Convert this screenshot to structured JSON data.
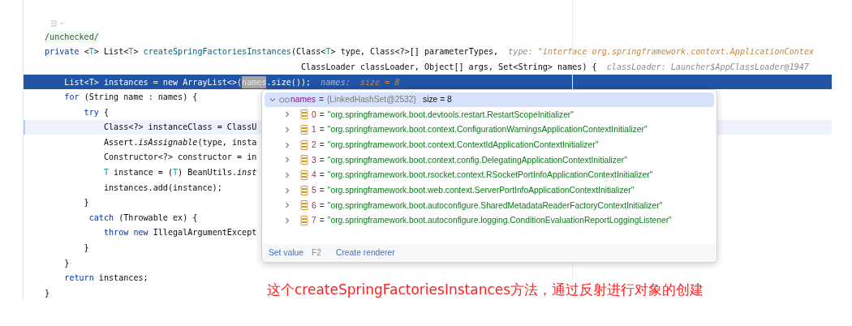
{
  "code_lines": [
    {
      "executing": false,
      "caret_line": false,
      "tokens": [
        {
          "kind": "inlay",
          "text": "/unchecked/"
        }
      ]
    },
    {
      "executing": false,
      "caret_line": false,
      "tokens": [
        {
          "kind": "kw",
          "text": "private "
        },
        {
          "kind": "plain",
          "text": "<"
        },
        {
          "kind": "tparam",
          "text": "T"
        },
        {
          "kind": "plain",
          "text": "> List<"
        },
        {
          "kind": "tparam",
          "text": "T"
        },
        {
          "kind": "plain",
          "text": "> "
        },
        {
          "kind": "method",
          "text": "createSpringFactoriesInstances"
        },
        {
          "kind": "plain",
          "text": "(Class<"
        },
        {
          "kind": "tparam",
          "text": "T"
        },
        {
          "kind": "plain",
          "text": "> type, Class<?>[] parameterTypes,  "
        },
        {
          "kind": "hint-name",
          "text": "type: "
        },
        {
          "kind": "hint-value",
          "text": "\"interface org.springframework.context.ApplicationContex"
        }
      ]
    },
    {
      "executing": false,
      "caret_line": false,
      "tokens": [
        {
          "kind": "plain",
          "text": "                                                    ClassLoader classLoader, Object[] args, Set<String> names) {  "
        },
        {
          "kind": "hint-name",
          "text": "classLoader: Launcher$AppClassLoader@1947"
        }
      ]
    },
    {
      "executing": true,
      "caret_line": false,
      "tokens": [
        {
          "kind": "plain",
          "text": "    List<T> instances = new ArrayList<>("
        },
        {
          "kind": "selected",
          "text": "names"
        },
        {
          "kind": "plain",
          "text": ".size());  "
        },
        {
          "kind": "hint-name",
          "text": "names:  "
        },
        {
          "kind": "hint-value",
          "text": "size = 8"
        }
      ]
    },
    {
      "executing": false,
      "caret_line": false,
      "tokens": [
        {
          "kind": "kw",
          "text": "    for "
        },
        {
          "kind": "plain",
          "text": "(String name : names) {"
        }
      ]
    },
    {
      "executing": false,
      "caret_line": false,
      "tokens": [
        {
          "kind": "kw",
          "text": "        try "
        },
        {
          "kind": "plain",
          "text": "{"
        }
      ]
    },
    {
      "executing": false,
      "caret_line": true,
      "tokens": [
        {
          "kind": "plain",
          "text": "            Class<?> instanceClass = ClassU"
        }
      ]
    },
    {
      "executing": false,
      "caret_line": false,
      "tokens": [
        {
          "kind": "plain",
          "text": "            Assert."
        },
        {
          "kind": "italic",
          "text": "isAssignable"
        },
        {
          "kind": "plain",
          "text": "(type, insta"
        }
      ]
    },
    {
      "executing": false,
      "caret_line": false,
      "tokens": [
        {
          "kind": "plain",
          "text": "            Constructor<?> constructor = in"
        }
      ]
    },
    {
      "executing": false,
      "caret_line": false,
      "tokens": [
        {
          "kind": "tparam",
          "text": "            T"
        },
        {
          "kind": "plain",
          "text": " instance = ("
        },
        {
          "kind": "tparam",
          "text": "T"
        },
        {
          "kind": "plain",
          "text": ") BeanUtils."
        },
        {
          "kind": "italic",
          "text": "inst"
        }
      ]
    },
    {
      "executing": false,
      "caret_line": false,
      "tokens": [
        {
          "kind": "plain",
          "text": "            instances.add(instance);"
        }
      ]
    },
    {
      "executing": false,
      "caret_line": false,
      "tokens": [
        {
          "kind": "plain",
          "text": "        }"
        }
      ]
    },
    {
      "executing": false,
      "caret_line": false,
      "tokens": [
        {
          "kind": "kw",
          "text": "         catch "
        },
        {
          "kind": "plain",
          "text": "(Throwable ex) {"
        }
      ]
    },
    {
      "executing": false,
      "caret_line": false,
      "tokens": [
        {
          "kind": "kw",
          "text": "            throw new "
        },
        {
          "kind": "plain",
          "text": "IllegalArgumentExcept"
        }
      ]
    },
    {
      "executing": false,
      "caret_line": false,
      "tokens": [
        {
          "kind": "plain",
          "text": "        }"
        }
      ]
    },
    {
      "executing": false,
      "caret_line": false,
      "tokens": [
        {
          "kind": "plain",
          "text": "    }"
        }
      ]
    },
    {
      "executing": false,
      "caret_line": false,
      "tokens": [
        {
          "kind": "kw",
          "text": "    return "
        },
        {
          "kind": "plain",
          "text": "instances;"
        }
      ]
    },
    {
      "executing": false,
      "caret_line": false,
      "tokens": [
        {
          "kind": "plain",
          "text": "}"
        }
      ]
    }
  ],
  "popup": {
    "header": {
      "expanded": true,
      "name": "names",
      "op": "=",
      "ref": "{LinkedHashSet@2532}",
      "extra": "size = 8"
    },
    "items": [
      {
        "expanded": false,
        "index": "0",
        "op": "=",
        "value": "\"org.springframework.boot.devtools.restart.RestartScopeInitializer\""
      },
      {
        "expanded": false,
        "index": "1",
        "op": "=",
        "value": "\"org.springframework.boot.context.ConfigurationWarningsApplicationContextInitializer\""
      },
      {
        "expanded": false,
        "index": "2",
        "op": "=",
        "value": "\"org.springframework.boot.context.ContextIdApplicationContextInitializer\""
      },
      {
        "expanded": false,
        "index": "3",
        "op": "=",
        "value": "\"org.springframework.boot.context.config.DelegatingApplicationContextInitializer\""
      },
      {
        "expanded": false,
        "index": "4",
        "op": "=",
        "value": "\"org.springframework.boot.rsocket.context.RSocketPortInfoApplicationContextInitializer\""
      },
      {
        "expanded": false,
        "index": "5",
        "op": "=",
        "value": "\"org.springframework.boot.web.context.ServerPortInfoApplicationContextInitializer\""
      },
      {
        "expanded": false,
        "index": "6",
        "op": "=",
        "value": "\"org.springframework.boot.autoconfigure.SharedMetadataReaderFactoryContextInitializer\""
      },
      {
        "expanded": false,
        "index": "7",
        "op": "=",
        "value": "\"org.springframework.boot.autoconfigure.logging.ConditionEvaluationReportLoggingListener\""
      }
    ],
    "actions": [
      {
        "label": "Set value",
        "shortcut": "F2"
      },
      {
        "label": "Create renderer"
      }
    ]
  },
  "annotation": "这个createSpringFactoriesInstances方法，通过反射进行对象的创建"
}
